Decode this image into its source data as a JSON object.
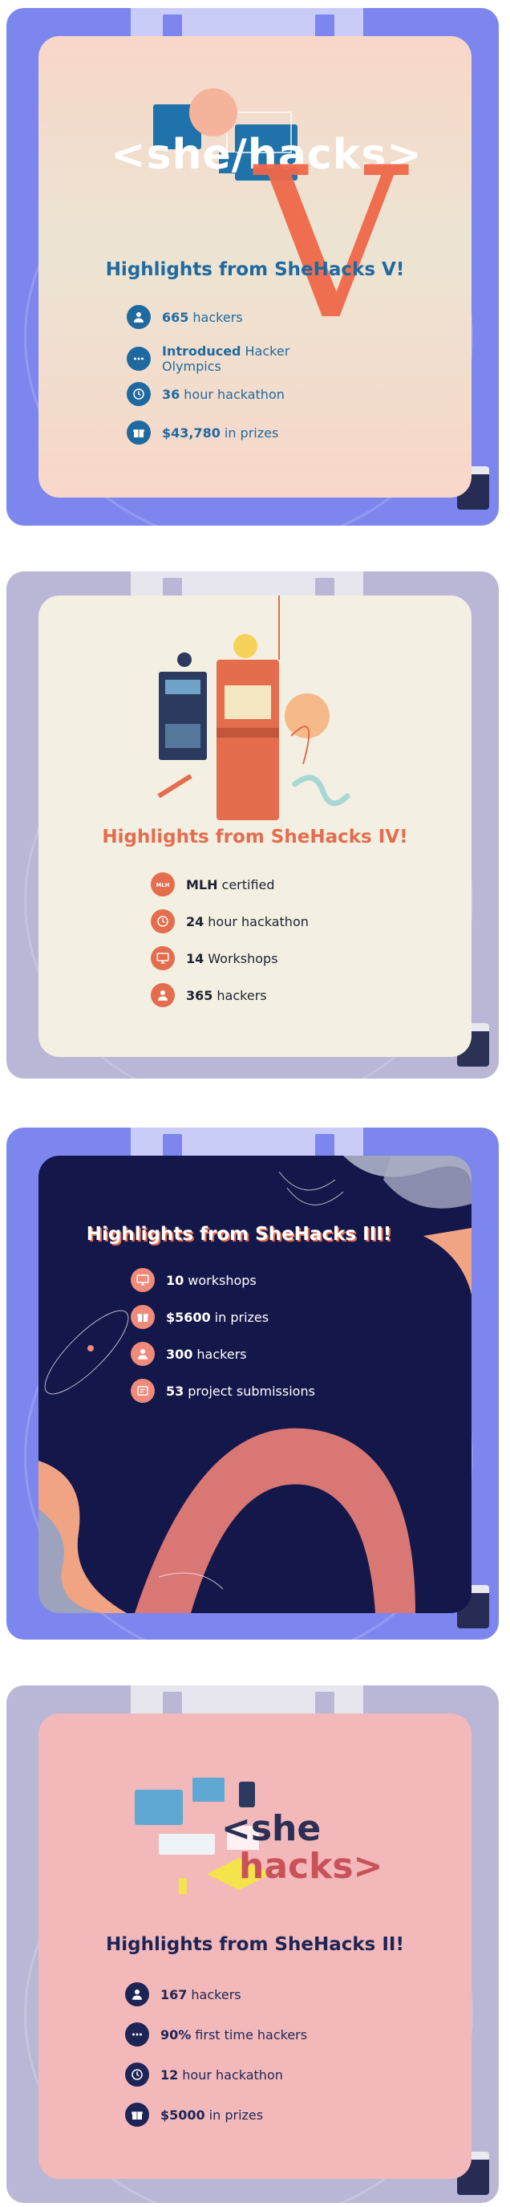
{
  "colors": {
    "v_disk": "#7c86ee",
    "v_label": "#f7d9cc",
    "v_text": "#1e6aa0",
    "v_accent": "#f0684a",
    "iv_disk": "#b9b6d6",
    "iv_label": "#f3efe2",
    "iv_accent": "#e36d4d",
    "iii_disk": "#7c86ee",
    "iii_label": "#14174a",
    "iii_accent": "#f08a7a",
    "ii_disk": "#bab7d6",
    "ii_label": "#f3b9ba",
    "ii_text": "#1d2556"
  },
  "shehacks_v": {
    "logo_text": "<she/hacks>",
    "roman": "V",
    "title": "Highlights from SheHacks V!",
    "stats": [
      {
        "icon": "person-icon",
        "bold": "665",
        "text": "hackers"
      },
      {
        "icon": "dots-icon",
        "bold": "Introduced",
        "text": "Hacker Olympics"
      },
      {
        "icon": "clock-icon",
        "bold": "36",
        "text": "hour hackathon"
      },
      {
        "icon": "gift-icon",
        "bold": "$43,780",
        "text": "in prizes"
      }
    ]
  },
  "shehacks_iv": {
    "title": "Highlights from SheHacks IV!",
    "stats": [
      {
        "icon": "mlh-icon",
        "bold": "MLH",
        "text": "certified"
      },
      {
        "icon": "clock-icon",
        "bold": "24",
        "text": "hour hackathon"
      },
      {
        "icon": "monitor-icon",
        "bold": "14",
        "text": "Workshops"
      },
      {
        "icon": "person-icon",
        "bold": "365",
        "text": "hackers"
      }
    ]
  },
  "shehacks_iii": {
    "title": "Highlights from SheHacks III!",
    "stats": [
      {
        "icon": "monitor-icon",
        "bold": "10",
        "text": "workshops"
      },
      {
        "icon": "gift-icon",
        "bold": "$5600",
        "text": "in prizes"
      },
      {
        "icon": "person-icon",
        "bold": "300",
        "text": "hackers"
      },
      {
        "icon": "submission-icon",
        "bold": "53",
        "text": "project submissions"
      }
    ]
  },
  "shehacks_ii": {
    "logo_line1": "<she",
    "logo_line2": "hacks>",
    "title": "Highlights from SheHacks II!",
    "stats": [
      {
        "icon": "person-icon",
        "bold": "167",
        "text": "hackers"
      },
      {
        "icon": "dots-icon",
        "bold": "90%",
        "text": "first time hackers"
      },
      {
        "icon": "clock-icon",
        "bold": "12",
        "text": "hour hackathon"
      },
      {
        "icon": "gift-icon",
        "bold": "$5000",
        "text": "in prizes"
      }
    ]
  }
}
